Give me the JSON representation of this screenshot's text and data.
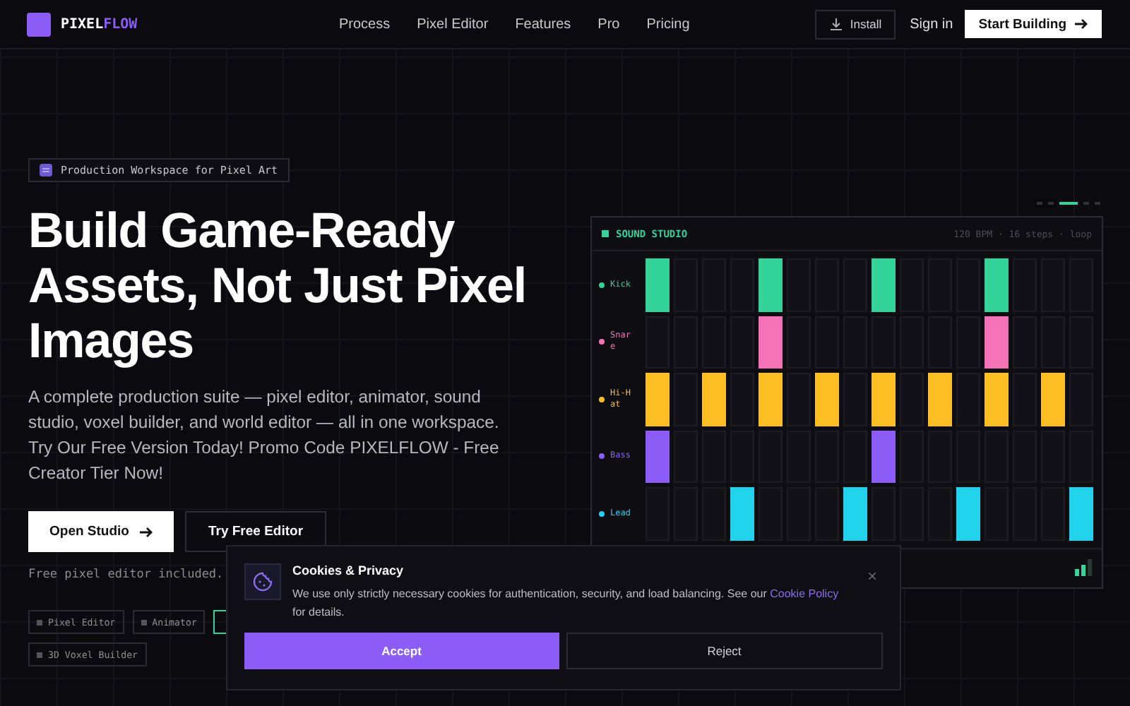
{
  "brand": {
    "name_a": "PIXEL",
    "name_b": "FLOW"
  },
  "nav": [
    {
      "label": "Process"
    },
    {
      "label": "Pixel Editor"
    },
    {
      "label": "Features"
    },
    {
      "label": "Pro"
    },
    {
      "label": "Pricing"
    }
  ],
  "header_actions": {
    "install": "Install",
    "sign_in": "Sign in",
    "start": "Start Building"
  },
  "hero": {
    "badge": "Production Workspace for Pixel Art",
    "title": "Build Game-Ready Assets, Not Just Pixel Images",
    "lead": "A complete production suite — pixel editor, animator, sound studio, voxel builder, and world editor — all in one workspace. Try Our Free Version Today! Promo Code PIXELFLOW - Free Creator Tier Now!",
    "primary": "Open Studio",
    "secondary": "Try Free Editor",
    "note": "Free pixel editor included.",
    "tags": [
      {
        "label": "Pixel Editor",
        "active": false
      },
      {
        "label": "Animator",
        "active": false
      },
      {
        "active": true
      },
      {
        "label": "3D Voxel Builder",
        "active": false
      }
    ]
  },
  "slides": [
    {
      "selected": false
    },
    {
      "selected": false
    },
    {
      "selected": true
    },
    {
      "selected": false
    },
    {
      "selected": false
    }
  ],
  "studio": {
    "title": "SOUND STUDIO",
    "meta": "120 BPM · 16 steps · loop",
    "tracks": [
      {
        "name": "Kick",
        "color": "#34d399",
        "steps": [
          true,
          false,
          false,
          false,
          true,
          false,
          false,
          false,
          true,
          false,
          false,
          false,
          true,
          false,
          false,
          false
        ]
      },
      {
        "name": "Snare",
        "color": "#f472b6",
        "steps": [
          false,
          false,
          false,
          false,
          true,
          false,
          false,
          false,
          false,
          false,
          false,
          false,
          true,
          false,
          false,
          false
        ]
      },
      {
        "name": "Hi-Hat",
        "color": "#fbbf24",
        "steps": [
          true,
          false,
          true,
          false,
          true,
          false,
          true,
          false,
          true,
          false,
          true,
          false,
          true,
          false,
          true,
          false
        ]
      },
      {
        "name": "Bass",
        "color": "#8b5cf6",
        "steps": [
          true,
          false,
          false,
          false,
          false,
          false,
          false,
          false,
          true,
          false,
          false,
          false,
          false,
          false,
          false,
          false
        ]
      },
      {
        "name": "Lead",
        "color": "#22d3ee",
        "steps": [
          false,
          false,
          false,
          true,
          false,
          false,
          false,
          true,
          false,
          false,
          false,
          true,
          false,
          false,
          false,
          true
        ]
      }
    ]
  },
  "cookie": {
    "title": "Cookies & Privacy",
    "text": "We use only strictly necessary cookies for authentication, security, and load balancing. See our ",
    "link": "Cookie Policy",
    "text_end": " for details.",
    "accept": "Accept",
    "reject": "Reject",
    "close": "×"
  }
}
